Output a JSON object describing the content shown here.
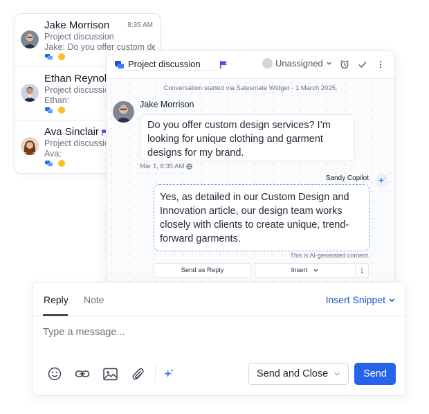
{
  "colors": {
    "accent": "#2563eb",
    "flag": "#7c3aed",
    "ai_border": "#7aa7e6",
    "emoji": "#fbbf24"
  },
  "conversations": [
    {
      "name": "Jake Morrison",
      "time": "8:35 AM",
      "subject": "Project discussion",
      "preview": "Jake: Do you offer custom design services?",
      "flag": false,
      "icons": [
        "chat-icon",
        "emoji-icon"
      ]
    },
    {
      "name": "Ethan Reynolds",
      "time": "",
      "subject": "Project discussion",
      "preview": "Ethan:",
      "flag": false,
      "icons": [
        "chat-icon",
        "emoji-icon"
      ]
    },
    {
      "name": "Ava Sinclair",
      "time": "",
      "subject": "Project discussion",
      "preview": "Ava:",
      "flag": true,
      "icons": [
        "chat-icon",
        "emoji-icon"
      ]
    }
  ],
  "chat": {
    "title": "Project discussion",
    "assignee": "Unassigned",
    "header_icons": [
      "alarm-clock-icon",
      "check-icon",
      "more-vertical-icon"
    ],
    "started_text": "Conversation started via Salesmate Widget - 1 March 2025.",
    "incoming": {
      "sender": "Jake Morrison",
      "text": "Do you offer custom design services? I’m looking for unique clothing and garment designs for my brand.",
      "meta": "Mar 1, 8:35 AM"
    },
    "ai_reply": {
      "sender": "Sandy Copilot",
      "text": "Yes, as detailed in our Custom Design and Innovation article, our design team works closely with clients to create unique, trend-forward garments.",
      "note": "This is AI-generated content.",
      "send_as_reply_label": "Send as Reply",
      "insert_label": "Insert"
    }
  },
  "composer": {
    "tabs": [
      "Reply",
      "Note"
    ],
    "active_tab": "Reply",
    "insert_snippet_label": "Insert Snippet",
    "placeholder": "Type a message...",
    "tools": [
      "emoji-icon",
      "link-icon",
      "image-icon",
      "attachment-icon",
      "ai-sparkle-icon"
    ],
    "send_close_label": "Send and Close",
    "send_label": "Send"
  }
}
